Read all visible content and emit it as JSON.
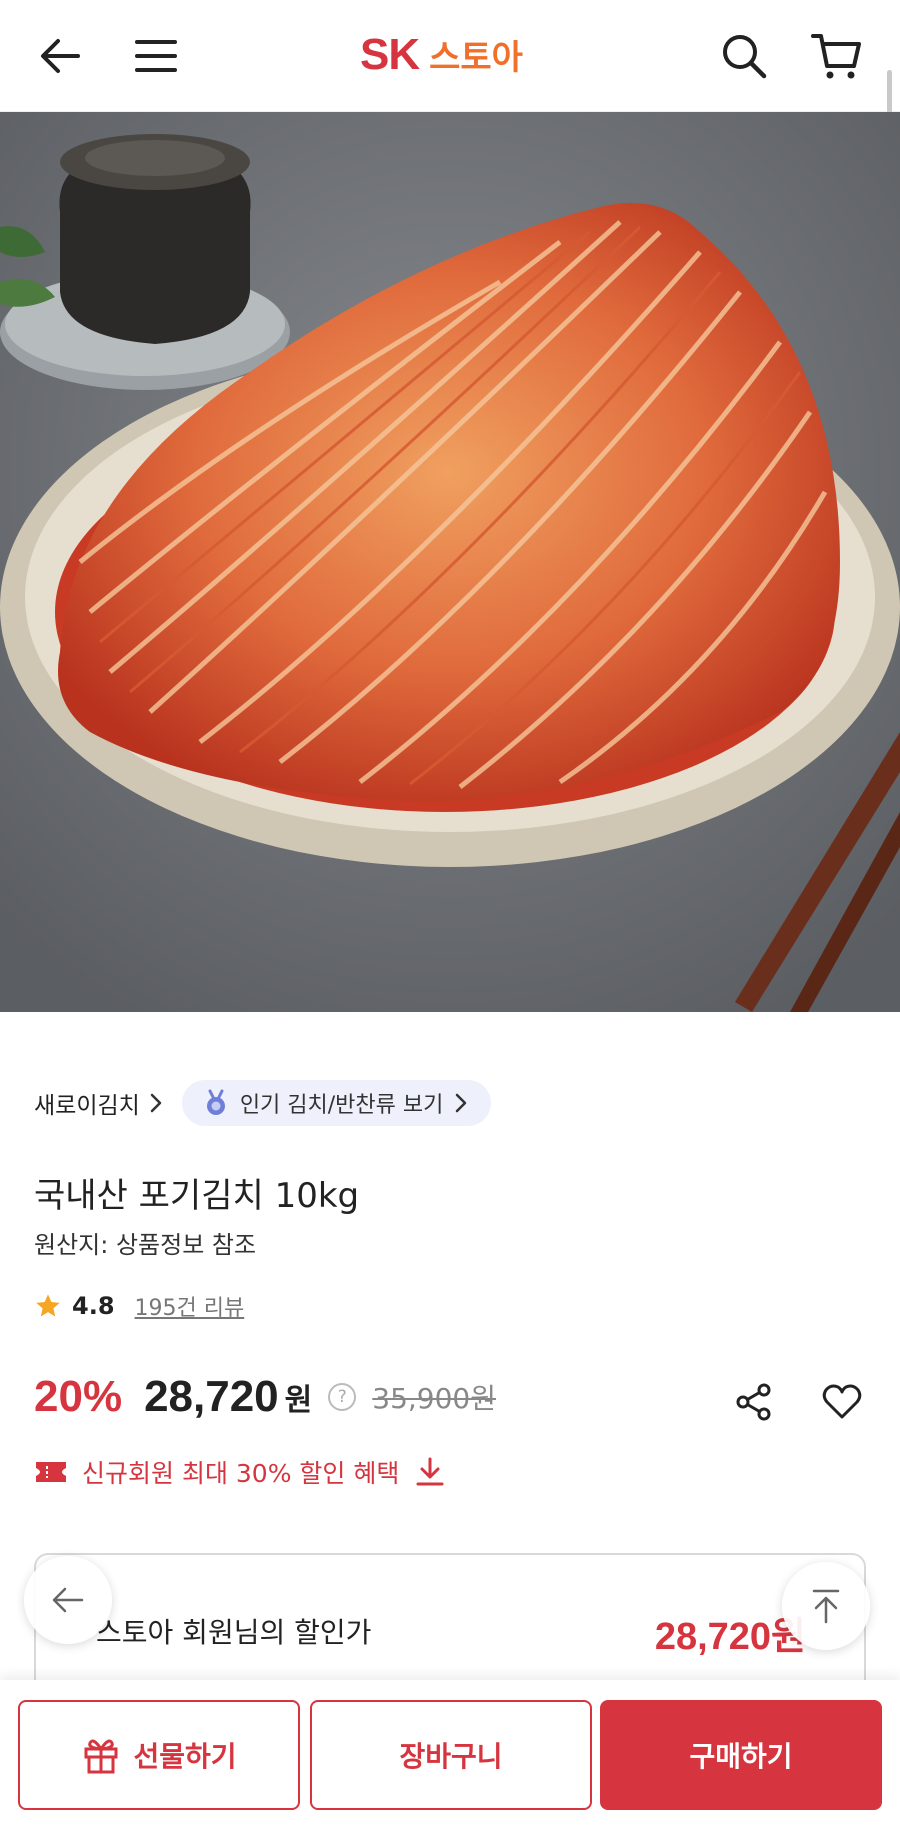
{
  "header": {
    "logo_sk": "SK",
    "logo_store": "스토아",
    "brand_color": "#d6353f",
    "accent_color": "#f0702b",
    "icons": [
      "back-arrow-icon",
      "menu-icon",
      "search-icon",
      "cart-icon"
    ]
  },
  "product": {
    "image": "kimchi-photo",
    "breadcrumb_category": "새로이김치",
    "popular_chip_label": "인기 김치/반찬류 보기",
    "title": "국내산 포기김치 10kg",
    "origin": "원산지: 상품정보 참조",
    "rating": "4.8",
    "review_count": "195건 리뷰",
    "discount_rate": "20%",
    "price": "28,720",
    "price_unit": "원",
    "help_mark": "?",
    "original_price": "35,900원",
    "coupon_text": "신규회원 최대 30% 할인 혜택"
  },
  "member_box": {
    "label": "스토아 회원님의 할인가",
    "price": "28,720원"
  },
  "bottom_bar": {
    "gift_label": "선물하기",
    "cart_label": "장바구니",
    "buy_label": "구매하기"
  }
}
